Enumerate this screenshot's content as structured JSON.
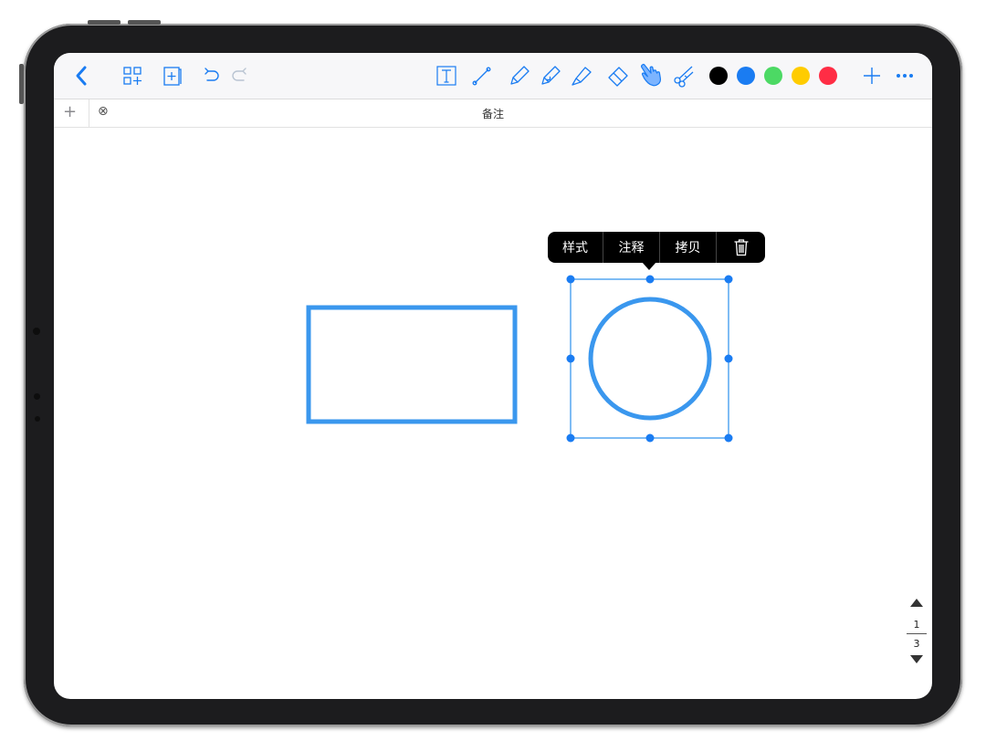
{
  "toolbar": {
    "icons": [
      "back-icon",
      "page-grid-icon",
      "add-page-icon",
      "undo-icon",
      "redo-icon",
      "text-tool-icon",
      "line-tool-icon",
      "pen-icon",
      "pencil-icon",
      "highlighter-icon",
      "eraser-icon",
      "hand-tool-icon",
      "scissors-icon",
      "add-icon",
      "more-icon"
    ],
    "colors": [
      "#000000",
      "#1a7cf2",
      "#4cd964",
      "#ffcc00",
      "#ff2d45"
    ],
    "selected_tool": "hand-tool",
    "accent": "#1a7cf2"
  },
  "tabbar": {
    "add_label": "+",
    "close_label": "⊗",
    "title": "备注"
  },
  "context_menu": {
    "items": [
      "样式",
      "注释",
      "拷贝"
    ],
    "delete_icon": "trash-icon"
  },
  "pager": {
    "current": "1",
    "total": "3"
  },
  "canvas": {
    "shape_color": "#3a97ee",
    "shapes": [
      "rectangle",
      "circle"
    ],
    "selected_shape": "circle"
  }
}
